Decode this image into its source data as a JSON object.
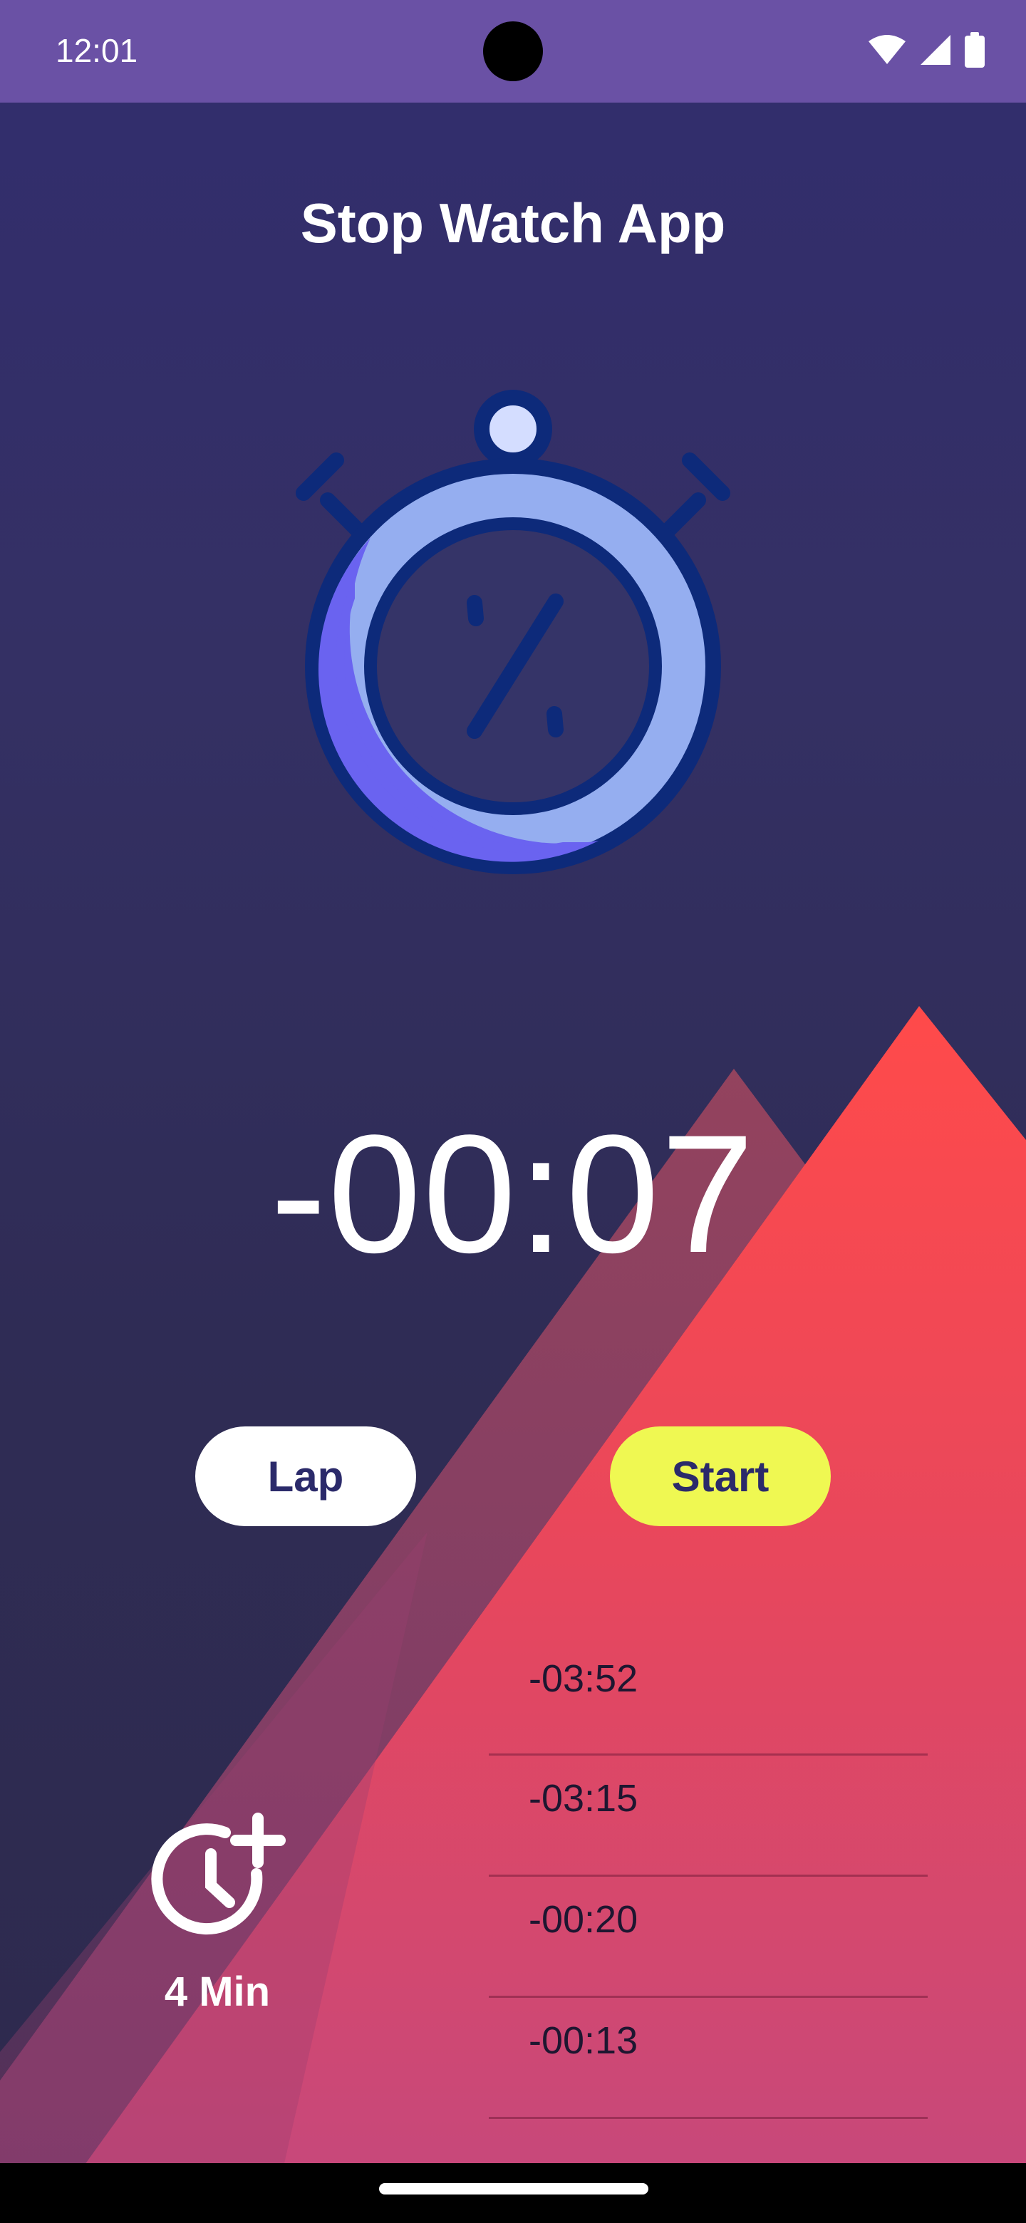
{
  "status_bar": {
    "time": "12:01",
    "icons": [
      "wifi-icon",
      "signal-icon",
      "battery-icon"
    ]
  },
  "app": {
    "title": "Stop Watch App"
  },
  "timer": {
    "display": "-00:07"
  },
  "buttons": {
    "lap_label": "Lap",
    "start_label": "Start"
  },
  "laps": [
    {
      "time": "-03:52"
    },
    {
      "time": "-03:15"
    },
    {
      "time": "-00:20"
    },
    {
      "time": "-00:13"
    }
  ],
  "add_time": {
    "icon": "clock-plus-icon",
    "label": "4 Min"
  },
  "colors": {
    "status_bar": "#6a51a5",
    "background": "#322d6e",
    "start_button": "#eff852",
    "lap_button": "#ffffff",
    "button_text": "#2b2a6a",
    "mountain": "#f2444f",
    "stopwatch_ring": "#95aef0",
    "stopwatch_outline": "#0d2a7a"
  }
}
